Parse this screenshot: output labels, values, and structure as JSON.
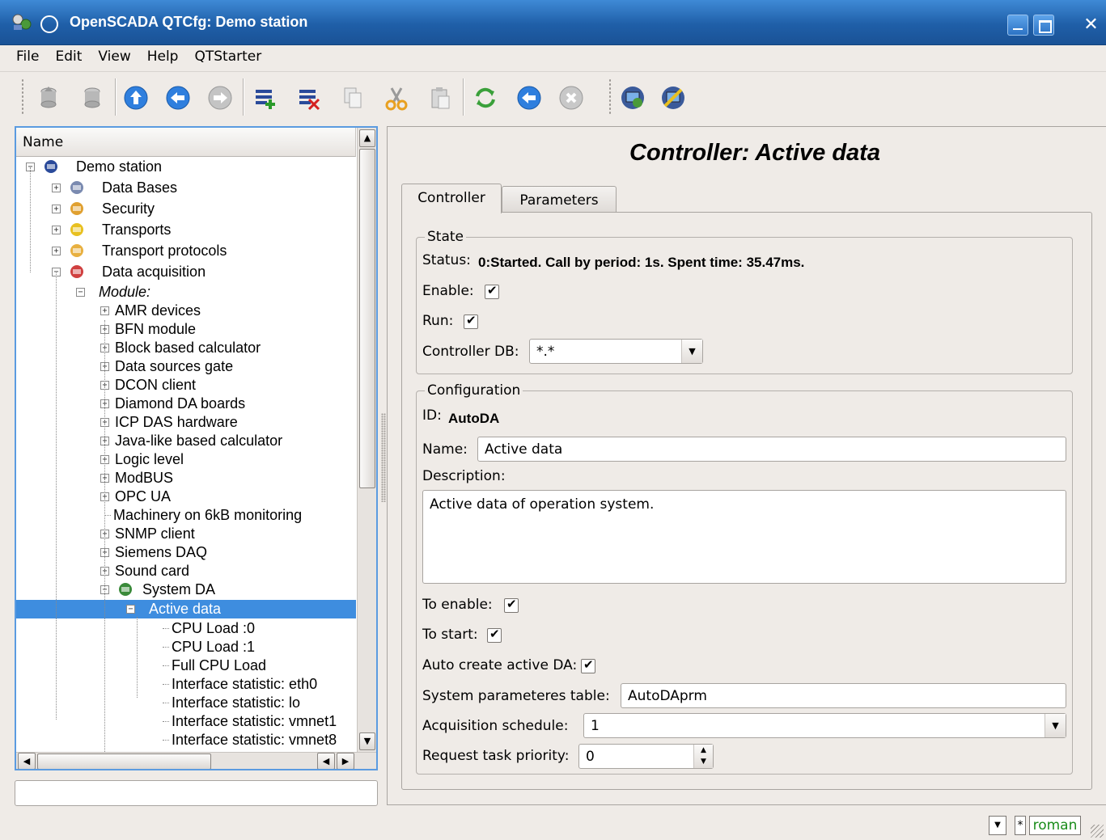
{
  "window": {
    "title": "OpenSCADA QTCfg: Demo station",
    "close_glyph": "✕"
  },
  "menu": [
    "File",
    "Edit",
    "View",
    "Help",
    "QTStarter"
  ],
  "toolbar": {
    "icons": [
      "db-load-icon",
      "db-save-icon",
      "up-icon",
      "back-icon",
      "forward-icon",
      "add-item-icon",
      "delete-item-icon",
      "copy-icon",
      "cut-icon",
      "paste-icon",
      "refresh-icon",
      "start-icon",
      "stop-icon",
      "station-icon",
      "station-settings-icon"
    ]
  },
  "tree": {
    "header": "Name",
    "items": [
      {
        "label": "Demo station",
        "depth": 0,
        "expander": "−",
        "icon": "station-icon"
      },
      {
        "label": "Data Bases",
        "depth": 1,
        "expander": "+",
        "icon": "database-icon"
      },
      {
        "label": "Security",
        "depth": 1,
        "expander": "+",
        "icon": "security-icon"
      },
      {
        "label": "Transports",
        "depth": 1,
        "expander": "+",
        "icon": "transport-icon"
      },
      {
        "label": "Transport protocols",
        "depth": 1,
        "expander": "+",
        "icon": "folder-icon"
      },
      {
        "label": "Data acquisition",
        "depth": 1,
        "expander": "−",
        "icon": "chart-icon"
      },
      {
        "label": "Module:",
        "depth": 2,
        "expander": "−",
        "italic": true
      },
      {
        "label": "AMR devices",
        "depth": 3,
        "expander": "+"
      },
      {
        "label": "BFN module",
        "depth": 3,
        "expander": "+"
      },
      {
        "label": "Block based calculator",
        "depth": 3,
        "expander": "+"
      },
      {
        "label": "Data sources gate",
        "depth": 3,
        "expander": "+"
      },
      {
        "label": "DCON client",
        "depth": 3,
        "expander": "+"
      },
      {
        "label": "Diamond DA boards",
        "depth": 3,
        "expander": "+"
      },
      {
        "label": "ICP DAS hardware",
        "depth": 3,
        "expander": "+"
      },
      {
        "label": "Java-like based calculator",
        "depth": 3,
        "expander": "+"
      },
      {
        "label": "Logic level",
        "depth": 3,
        "expander": "+"
      },
      {
        "label": "ModBUS",
        "depth": 3,
        "expander": "+"
      },
      {
        "label": "OPC UA",
        "depth": 3,
        "expander": "+"
      },
      {
        "label": "Machinery on 6kB monitoring",
        "depth": 3,
        "expander": ""
      },
      {
        "label": "SNMP client",
        "depth": 3,
        "expander": "+"
      },
      {
        "label": "Siemens DAQ",
        "depth": 3,
        "expander": "+"
      },
      {
        "label": "Sound card",
        "depth": 3,
        "expander": "+"
      },
      {
        "label": "System DA",
        "depth": 3,
        "expander": "−",
        "icon": "system-da-icon"
      },
      {
        "label": "Active data",
        "depth": 4,
        "expander": "−",
        "selected": true
      },
      {
        "label": "CPU Load :0",
        "depth": 5,
        "expander": ""
      },
      {
        "label": "CPU Load :1",
        "depth": 5,
        "expander": ""
      },
      {
        "label": "Full CPU Load",
        "depth": 5,
        "expander": ""
      },
      {
        "label": "Interface statistic: eth0",
        "depth": 5,
        "expander": ""
      },
      {
        "label": "Interface statistic: lo",
        "depth": 5,
        "expander": ""
      },
      {
        "label": "Interface statistic: vmnet1",
        "depth": 5,
        "expander": ""
      },
      {
        "label": "Interface statistic: vmnet8",
        "depth": 5,
        "expander": ""
      }
    ]
  },
  "page": {
    "title": "Controller: Active data",
    "tabs": [
      "Controller",
      "Parameters"
    ],
    "state": {
      "group_title": "State",
      "status_label": "Status:",
      "status_value": "0:Started. Call by period: 1s. Spent time: 35.47ms.",
      "enable_label": "Enable:",
      "enable_checked": true,
      "run_label": "Run:",
      "run_checked": true,
      "db_label": "Controller DB:",
      "db_value": "*.*"
    },
    "config": {
      "group_title": "Configuration",
      "id_label": "ID:",
      "id_value": "AutoDA",
      "name_label": "Name:",
      "name_value": "Active data",
      "description_label": "Description:",
      "description_value": "Active data of operation system.",
      "to_enable_label": "To enable:",
      "to_enable_checked": true,
      "to_start_label": "To start:",
      "to_start_checked": true,
      "auto_create_label": "Auto create active DA:",
      "auto_create_checked": true,
      "sys_table_label": "System parameteres table:",
      "sys_table_value": "AutoDAprm",
      "schedule_label": "Acquisition schedule:",
      "schedule_value": "1",
      "priority_label": "Request task priority:",
      "priority_value": "0"
    }
  },
  "statusbar": {
    "star": "*",
    "user": "roman"
  },
  "colors": {
    "titlebar": "#2a6fbd",
    "selection": "#3e8ddf",
    "user_text": "#1a8c1a"
  }
}
